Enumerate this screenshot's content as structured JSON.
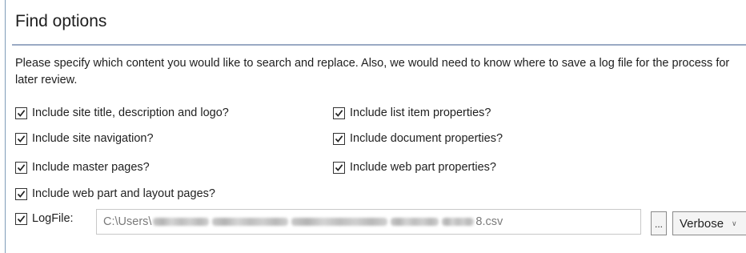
{
  "panel": {
    "title": "Find options",
    "description": "Please specify which content you would like to search and replace. Also, we would need to know where to save a log file for the process for later review."
  },
  "options_left": [
    {
      "label": "Include site title, description and logo?",
      "checked": true
    },
    {
      "label": "Include site navigation?",
      "checked": true
    },
    {
      "label": "Include master pages?",
      "checked": true
    },
    {
      "label": "Include web part and layout pages?",
      "checked": true
    }
  ],
  "options_right": [
    {
      "label": "Include list item properties?",
      "checked": true
    },
    {
      "label": "Include document properties?",
      "checked": true
    },
    {
      "label": "Include web part properties?",
      "checked": true
    }
  ],
  "logfile": {
    "label": "LogFile:",
    "checked": true,
    "path_prefix": "C:\\Users\\",
    "path_suffix": "8.csv",
    "browse_label": "...",
    "level": "Verbose"
  },
  "icons": {
    "checkbox": "checkmark-icon",
    "dropdown": "chevron-down-icon"
  }
}
